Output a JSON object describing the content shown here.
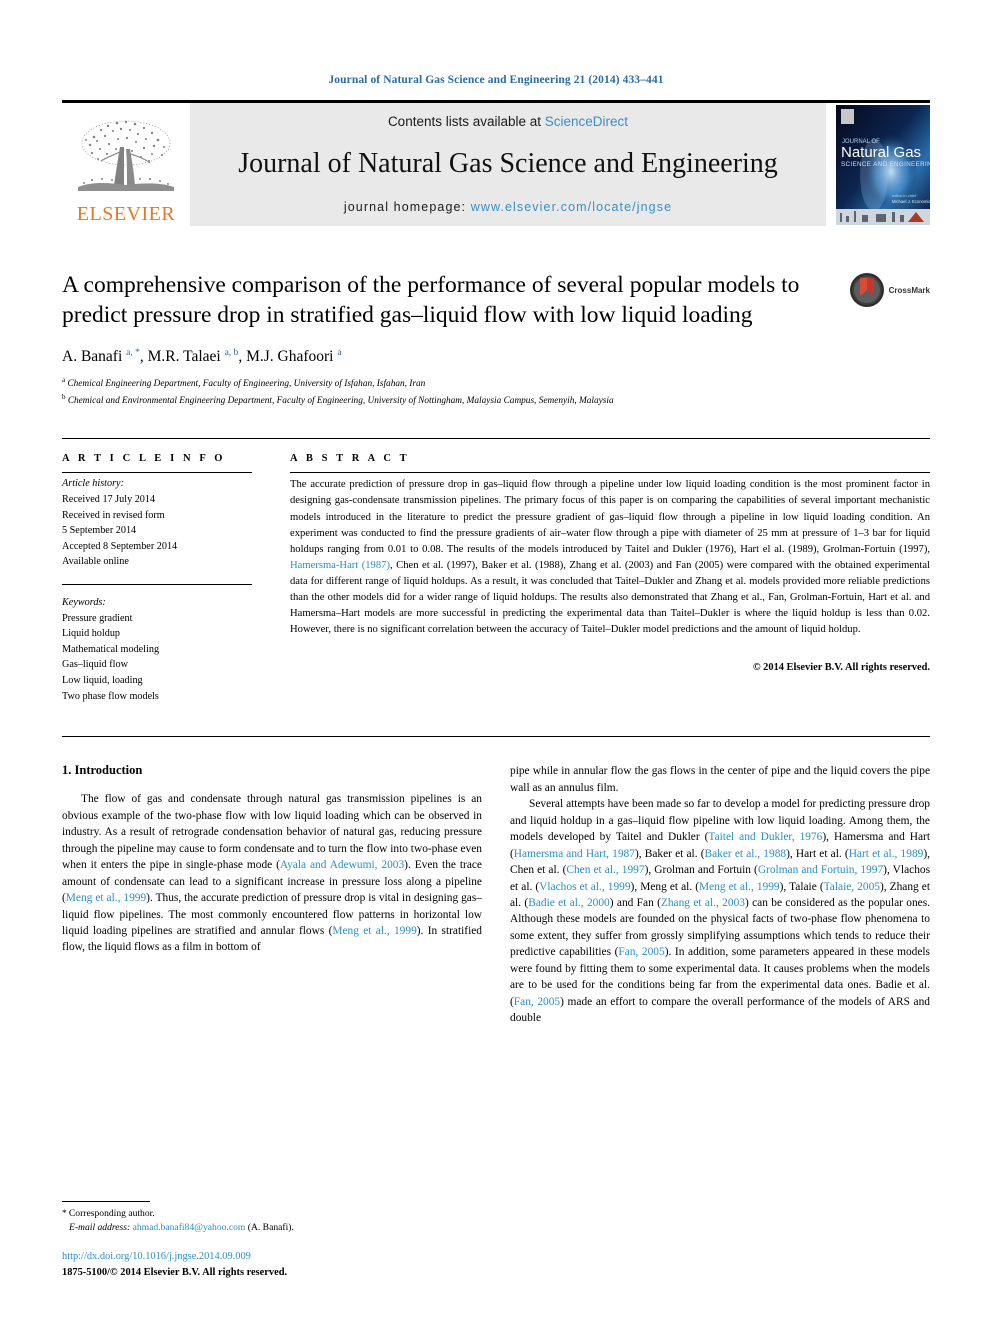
{
  "running_head": "Journal of Natural Gas Science and Engineering 21 (2014) 433–441",
  "banner": {
    "publisher_name": "ELSEVIER",
    "contents_prefix": "Contents lists available at ",
    "contents_link": "ScienceDirect",
    "journal_title": "Journal of Natural Gas Science and Engineering",
    "homepage_prefix": "journal homepage: ",
    "homepage_url": "www.elsevier.com/locate/jngse",
    "cover_title": "Natural Gas",
    "cover_subtitle": "SCIENCE AND ENGINEERING",
    "link_color": "#3a8fc4",
    "banner_bg": "#e9e9e9",
    "elsevier_orange": "#e87722"
  },
  "article": {
    "title": "A comprehensive comparison of the performance of several popular models to predict pressure drop in stratified gas–liquid flow with low liquid loading",
    "crossmark_label": "CrossMark",
    "authors_html": "A. Banafi <sup>a, *</sup>, M.R. Talaei <sup>a, b</sup>, M.J. Ghafoori <sup>a</sup>",
    "affiliation_a": "Chemical Engineering Department, Faculty of Engineering, University of Isfahan, Isfahan, Iran",
    "affiliation_b": "Chemical and Environmental Engineering Department, Faculty of Engineering, University of Nottingham, Malaysia Campus, Semenyih, Malaysia"
  },
  "article_info": {
    "heading": "A R T I C L E   I N F O",
    "history_label": "Article history:",
    "history_lines": [
      "Received 17 July 2014",
      "Received in revised form",
      "5 September 2014",
      "Accepted 8 September 2014",
      "Available online"
    ],
    "keywords_label": "Keywords:",
    "keywords": [
      "Pressure gradient",
      "Liquid holdup",
      "Mathematical modeling",
      "Gas–liquid flow",
      "Low liquid, loading",
      "Two phase flow models"
    ]
  },
  "abstract": {
    "heading": "A B S T R A C T",
    "text_part1": "The accurate prediction of pressure drop in gas–liquid flow through a pipeline under low liquid loading condition is the most prominent factor in designing gas-condensate transmission pipelines. The primary focus of this paper is on comparing the capabilities of several important mechanistic models introduced in the literature to predict the pressure gradient of gas–liquid flow through a pipeline in low liquid loading condition. An experiment was conducted to find the pressure gradients of air–water flow through a pipe with diameter of 25 mm at pressure of 1–3 bar for liquid holdups ranging from 0.01 to 0.08. The results of the models introduced by Taitel and Dukler (1976), Hart el al. (1989), Grolman-Fortuin (1997), ",
    "link1": "Hamersma-Hart (1987)",
    "text_part2": ", Chen et al. (1997), Baker et al. (1988), Zhang et al. (2003) and Fan (2005) were compared with the obtained experimental data for different range of liquid holdups. As a result, it was concluded that Taitel–Dukler and Zhang et al. models provided more reliable predictions than the other models did for a wider range of liquid holdups. The results also demonstrated that Zhang et al., Fan, Grolman-Fortuin, Hart et al. and Hamersma–Hart models are more successful in predicting the experimental data than Taitel–Dukler is where the liquid holdup is less than 0.02. However, there is no significant correlation between the accuracy of Taitel–Dukler model predictions and the amount of liquid holdup.",
    "copyright": "© 2014 Elsevier B.V. All rights reserved."
  },
  "introduction": {
    "heading": "1.  Introduction",
    "left_p1_a": "The flow of gas and condensate through natural gas transmission pipelines is an obvious example of the two-phase flow with low liquid loading which can be observed in industry. As a result of retrograde condensation behavior of natural gas, reducing pressure through the pipeline may cause to form condensate and to turn the flow into two-phase even when it enters the pipe in single-phase mode (",
    "left_link1": "Ayala and Adewumi, 2003",
    "left_p1_b": "). Even the trace amount of condensate can lead to a significant increase in pressure loss along a pipeline (",
    "left_link2": "Meng et al., 1999",
    "left_p1_c": "). Thus, the accurate prediction of pressure drop is vital in designing gas–liquid flow pipelines. The most commonly encountered flow patterns in horizontal low liquid loading pipelines are stratified and annular flows (",
    "left_link3": "Meng et al., 1999",
    "left_p1_d": "). In stratified flow, the liquid flows as a film in bottom of",
    "right_p1": "pipe while in annular flow the gas flows in the center of pipe and the liquid covers the pipe wall as an annulus film.",
    "right_p2_a": "Several attempts have been made so far to develop a model for predicting pressure drop and liquid holdup in a gas–liquid flow pipeline with low liquid loading. Among them, the models developed by Taitel and Dukler (",
    "right_link1": "Taitel and Dukler, 1976",
    "right_p2_b": "), Hamersma and Hart (",
    "right_link2": "Hamersma and Hart, 1987",
    "right_p2_c": "), Baker et al. (",
    "right_link3": "Baker et al., 1988",
    "right_p2_d": "), Hart et al. (",
    "right_link4": "Hart et al., 1989",
    "right_p2_e": "), Chen et al. (",
    "right_link5": "Chen et al., 1997",
    "right_p2_f": "), Grolman and Fortuin (",
    "right_link6": "Grolman and Fortuin, 1997",
    "right_p2_g": "), Vlachos et al. (",
    "right_link7": "Vlachos et al., 1999",
    "right_p2_h": "), Meng et al. (",
    "right_link8": "Meng et al., 1999",
    "right_p2_i": "), Talaie (",
    "right_link9": "Talaie, 2005",
    "right_p2_j": "), Zhang et al. (",
    "right_link10": "Badie et al., 2000",
    "right_p2_k": ") and Fan (",
    "right_link11": "Zhang et al., 2003",
    "right_p2_l": ") can be considered as the popular ones. Although these models are founded on the physical facts of two-phase flow phenomena to some extent, they suffer from grossly simplifying assumptions which tends to reduce their predictive capabilities (",
    "right_link12": "Fan, 2005",
    "right_p2_m": "). In addition, some parameters appeared in these models were found by fitting them to some experimental data. It causes problems when the models are to be used for the conditions being far from the experimental data ones. Badie et al. (",
    "right_link13": "Fan, 2005",
    "right_p2_n": ") made an effort to compare the overall performance of the models of ARS and double"
  },
  "footer": {
    "corresponding_star": "*",
    "corresponding_label": "Corresponding author.",
    "email_label": "E-mail address:",
    "email": "ahmad.banafi84@yahoo.com",
    "email_suffix": "(A. Banafi).",
    "doi": "http://dx.doi.org/10.1016/j.jngse.2014.09.009",
    "issn_line": "1875-5100/© 2014 Elsevier B.V. All rights reserved."
  }
}
